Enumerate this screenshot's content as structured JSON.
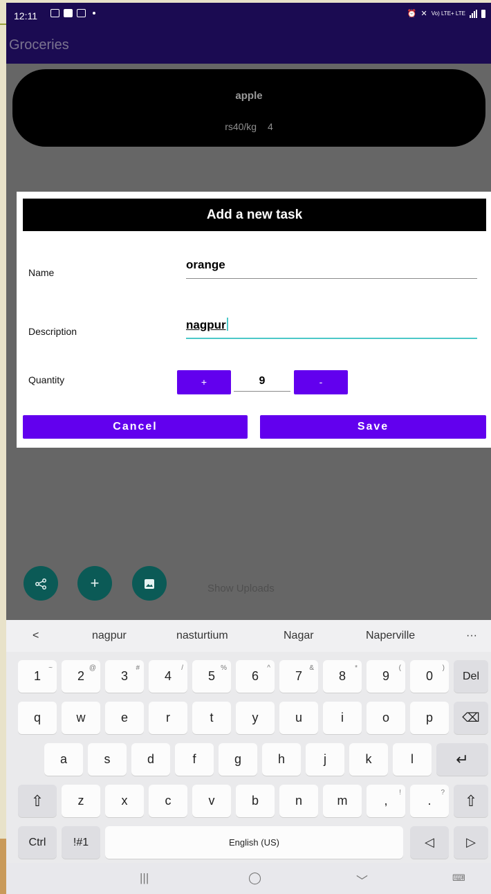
{
  "status_bar": {
    "time": "12:11",
    "network_label": "Vo) LTE+ LTE"
  },
  "app_bar": {
    "title": "Groceries"
  },
  "list_card": {
    "name": "apple",
    "price": "rs40/kg",
    "quantity": "4"
  },
  "dialog": {
    "title": "Add a new task",
    "name_label": "Name",
    "name_value": "orange",
    "description_label": "Description",
    "description_value": "nagpur",
    "quantity_label": "Quantity",
    "increment_label": "+",
    "quantity_value": "9",
    "decrement_label": "-",
    "cancel_label": "Cancel",
    "save_label": "Save"
  },
  "fabs": {
    "icons": [
      "share-icon",
      "plus-icon",
      "image-icon"
    ],
    "plus_label": "+"
  },
  "show_uploads_label": "Show Uploads",
  "keyboard": {
    "suggestions": [
      "<",
      "nagpur",
      "nasturtium",
      "Nagar",
      "Naperville",
      "···"
    ],
    "number_row": [
      "1",
      "2",
      "3",
      "4",
      "5",
      "6",
      "7",
      "8",
      "9",
      "0"
    ],
    "number_hints": [
      "~",
      "@",
      "#",
      "/",
      "%",
      "^",
      "&",
      "*",
      "(",
      ")"
    ],
    "del_label": "Del",
    "row_q": [
      "q",
      "w",
      "e",
      "r",
      "t",
      "y",
      "u",
      "i",
      "o",
      "p"
    ],
    "row_a": [
      "a",
      "s",
      "d",
      "f",
      "g",
      "h",
      "j",
      "k",
      "l"
    ],
    "row_z": [
      "z",
      "x",
      "c",
      "v",
      "b",
      "n",
      "m",
      ",",
      "."
    ],
    "row_z_hints": [
      "!",
      "?"
    ],
    "ctrl_label": "Ctrl",
    "symbols_label": "!#1",
    "space_label": "English (US)",
    "shift_icon": "⇧",
    "backspace_icon": "⌫",
    "enter_icon": "↵",
    "left_arrow_icon": "◁",
    "right_arrow_icon": "▷"
  },
  "nav_bar": {
    "recents_icon": "|||",
    "home_icon": "◯",
    "back_icon": "﹀",
    "keyboard_icon": "⌨"
  },
  "colors": {
    "primary": "#6200ee",
    "status_bar": "#1b0b52",
    "fab": "#0b5a56",
    "accent_line": "#4bc8c8"
  }
}
